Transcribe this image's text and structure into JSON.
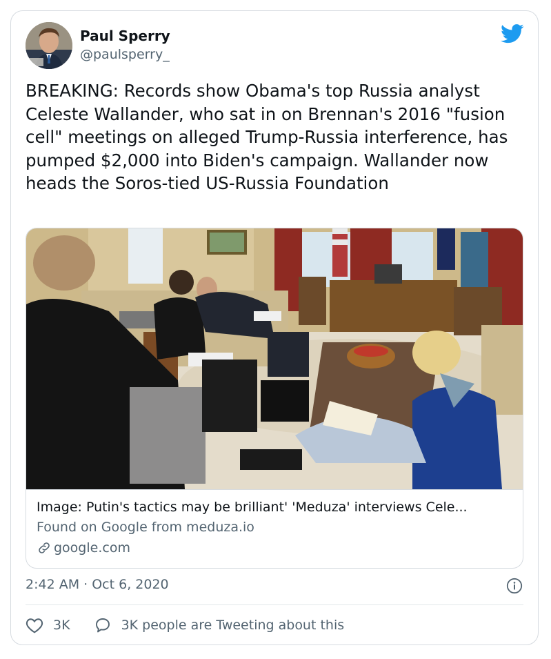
{
  "tweet": {
    "author_name": "Paul Sperry",
    "author_handle": "@paulsperry_",
    "text": "BREAKING: Records show Obama's top Russia analyst Celeste Wallander, who sat in on Brennan's 2016 \"fusion cell\" meetings on alleged Trump-Russia interference, has pumped $2,000 into Biden's campaign. Wallander now heads the Soros-tied US-Russia Foundation",
    "timestamp": "2:42 AM · Oct 6, 2020"
  },
  "media_card": {
    "title": "Image: Putin's tactics may be brilliant' 'Meduza' interviews Cele...",
    "description": "Found on Google from meduza.io",
    "domain": "google.com"
  },
  "actions": {
    "like_count": "3K",
    "conversation_text": "3K people are Tweeting about this"
  },
  "icons": {
    "brand": "twitter-bird-icon",
    "link": "link-icon",
    "info": "info-icon",
    "like": "heart-icon",
    "conversation": "speech-bubble-icon"
  },
  "colors": {
    "twitter_blue": "#1d9bf0",
    "secondary_text": "#536471",
    "border": "#d6dbe0"
  }
}
